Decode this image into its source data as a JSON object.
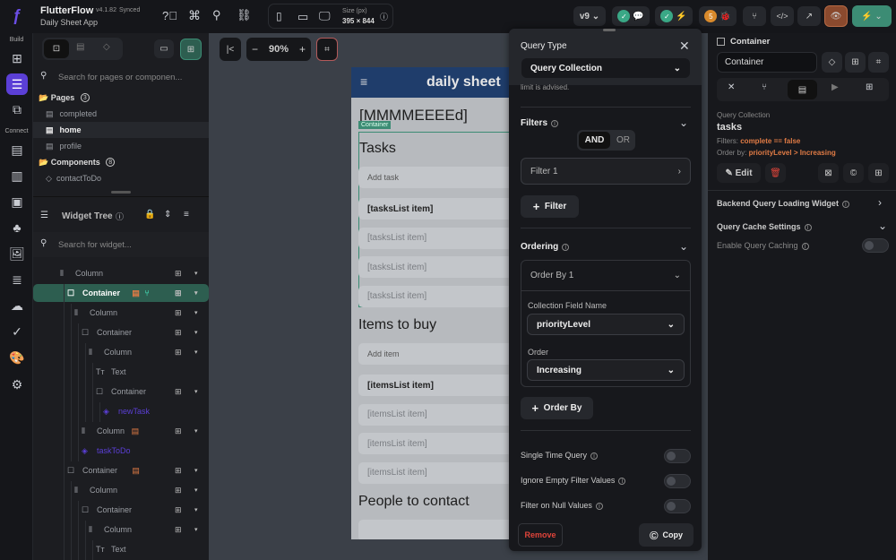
{
  "app": {
    "name": "FlutterFlow",
    "version": "v4.1.82",
    "sync": "Synced",
    "project": "Daily Sheet App",
    "size_label": "Size (px)",
    "size_value": "395 × 844",
    "branch": "v9",
    "warnings": "5"
  },
  "rail": {
    "build": "Build",
    "connect": "Connect"
  },
  "pages_panel": {
    "search_placeholder": "Search for pages or componen...",
    "pages_label": "Pages",
    "pages_count": "3",
    "pages": [
      "completed",
      "home",
      "profile"
    ],
    "selected_page": "home",
    "components_label": "Components",
    "components_count": "8",
    "components": [
      "contactToDo"
    ]
  },
  "widget_tree": {
    "title": "Widget Tree",
    "search_placeholder": "Search for widget...",
    "rows": [
      {
        "label": "Column",
        "type": "column",
        "level": 1
      },
      {
        "label": "Container",
        "type": "container",
        "level": 2,
        "selected": true,
        "badge": "query"
      },
      {
        "label": "Column",
        "type": "column",
        "level": 3
      },
      {
        "label": "Container",
        "type": "container",
        "level": 4
      },
      {
        "label": "Column",
        "type": "column",
        "level": 5
      },
      {
        "label": "Text",
        "type": "text",
        "level": 6,
        "noadd": true
      },
      {
        "label": "Container",
        "type": "container",
        "level": 6
      },
      {
        "label": "newTask",
        "type": "component",
        "level": 7,
        "noadd": true
      },
      {
        "label": "Column",
        "type": "column",
        "level": 4,
        "badge": "orange"
      },
      {
        "label": "taskToDo",
        "type": "component",
        "level": 4,
        "noadd": true
      },
      {
        "label": "Container",
        "type": "container",
        "level": 2,
        "badge": "orange"
      },
      {
        "label": "Column",
        "type": "column",
        "level": 3
      },
      {
        "label": "Container",
        "type": "container",
        "level": 4
      },
      {
        "label": "Column",
        "type": "column",
        "level": 5
      },
      {
        "label": "Text",
        "type": "text",
        "level": 6,
        "noadd": true
      }
    ]
  },
  "canvas": {
    "zoom": "90%"
  },
  "phone": {
    "title": "daily sheet",
    "date": "[MMMMEEEEd]",
    "container_tag": "Container",
    "tasks_heading": "Tasks",
    "add_task": "Add task",
    "task_items": [
      "[tasksList item]",
      "[tasksList item]",
      "[tasksList item]",
      "[tasksList item]"
    ],
    "items_heading": "Items to buy",
    "add_item": "Add item",
    "buy_items": [
      "[itemsList item]",
      "[itemsList item]",
      "[itemsList item]",
      "[itemsList item]"
    ],
    "people_heading": "People to contact"
  },
  "query_panel": {
    "title": "Query Type",
    "query_type": "Query Collection",
    "truncated_note": "limit is advised.",
    "filters_label": "Filters",
    "and_label": "AND",
    "or_label": "OR",
    "filter1": "Filter 1",
    "add_filter": "Filter",
    "ordering_label": "Ordering",
    "order_by_1": "Order By 1",
    "field_name_label": "Collection Field Name",
    "field_name_value": "priorityLevel",
    "order_label": "Order",
    "order_value": "Increasing",
    "add_order": "Order By",
    "single_time": "Single Time Query",
    "ignore_empty": "Ignore Empty Filter Values",
    "filter_null": "Filter on Null Values",
    "remove": "Remove",
    "copy": "Copy"
  },
  "props": {
    "widget_type": "Container",
    "widget_name": "Container",
    "query_heading": "Query Collection",
    "collection": "tasks",
    "filters_prefix": "Filters:",
    "filters_value": "complete == false",
    "order_prefix": "Order by:",
    "order_value": "priorityLevel > Increasing",
    "edit": "Edit",
    "loading_widget": "Backend Query Loading Widget",
    "cache_settings": "Query Cache Settings",
    "enable_cache": "Enable Query Caching"
  },
  "colors": {
    "accent_purple": "#5b3fd6",
    "accent_green": "#3c8c74",
    "highlight_orange": "#e07b45",
    "remove_red": "#e0443a",
    "phone_appbar": "#1f3d6b"
  }
}
